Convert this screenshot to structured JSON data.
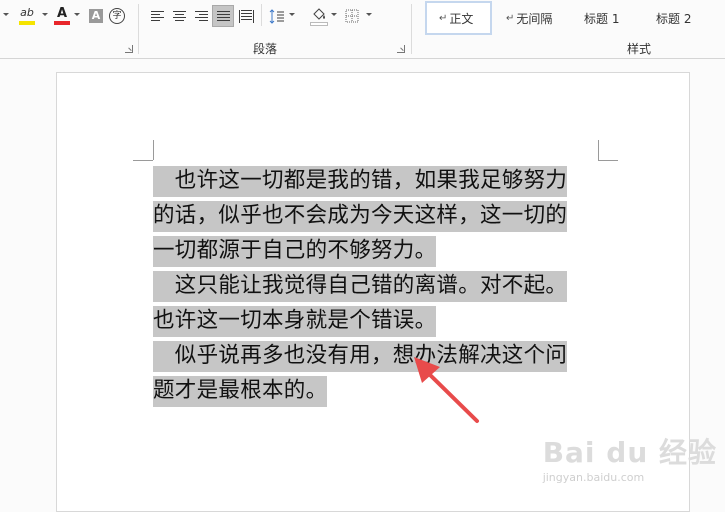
{
  "ribbon": {
    "font_group": {
      "highlight_label": "ab",
      "font_color_label": "A",
      "char_shading_label": "A",
      "enclose_label": "字"
    },
    "paragraph_group": {
      "label": "段落"
    },
    "styles_group": {
      "label": "样式",
      "items": [
        {
          "mark": "↵",
          "label": "正文"
        },
        {
          "mark": "↵",
          "label": "无间隔"
        },
        {
          "mark": "",
          "label": "标题 1"
        },
        {
          "mark": "",
          "label": "标题 2"
        }
      ]
    }
  },
  "document": {
    "lines": [
      "　也许这一切都是我的错，如果我足够努力",
      "的话，似乎也不会成为今天这样，这一切的",
      "一切都源于自己的不够努力。",
      "　这只能让我觉得自己错的离谱。对不起。",
      "也许这一切本身就是个错误。",
      "　似乎说再多也没有用，想办法解决这个问",
      "题才是最根本的。"
    ]
  },
  "colors": {
    "selection": "#c6c6c6",
    "highlight_underline": "#f5e400",
    "font_color_underline": "#e8262b",
    "arrow": "#e84b4b"
  },
  "watermark": {
    "logo": "Bai du 经验",
    "sub": "jingyan.baidu.com"
  }
}
